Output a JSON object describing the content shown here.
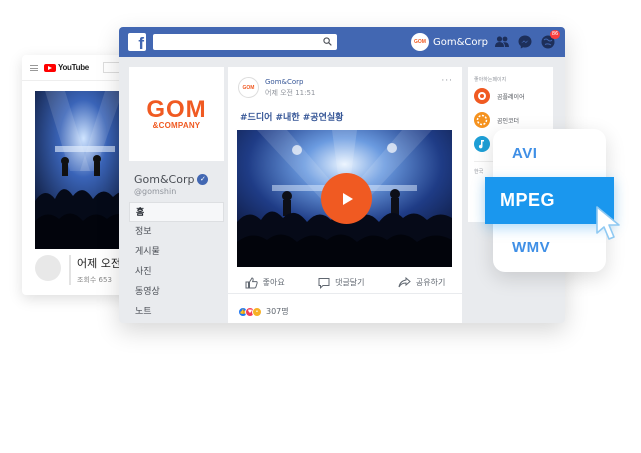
{
  "youtube": {
    "brand": "YouTube",
    "video_title": "어제 오전",
    "views": "조회수 653"
  },
  "facebook": {
    "search_placeholder": "",
    "profile_name": "Gom&Corp",
    "notification_count": "86",
    "page": {
      "logo_line1": "GOM",
      "logo_line2": "&COMPANY",
      "name": "Gom&Corp",
      "handle": "@gomshin",
      "nav": [
        "홈",
        "정보",
        "게시물",
        "사진",
        "동영상",
        "노트"
      ]
    },
    "post": {
      "author": "Gom&Corp",
      "time": "어제 오전 11:51",
      "text": "#드디어 #내한 #공연실황",
      "actions": [
        "좋아요",
        "댓글달기",
        "공유하기"
      ],
      "reaction_count": "307명"
    },
    "sidebar": {
      "title": "좋아하는페이지",
      "items": [
        "곰플레이어",
        "곰인코더",
        ""
      ],
      "footer": "한국"
    }
  },
  "formats": {
    "items": [
      "AVI",
      "MPEG",
      "WMV"
    ],
    "selected": "MPEG"
  },
  "colors": {
    "facebook_blue": "#4267b2",
    "gom_orange": "#f05a22",
    "format_blue": "#1a97ee"
  }
}
